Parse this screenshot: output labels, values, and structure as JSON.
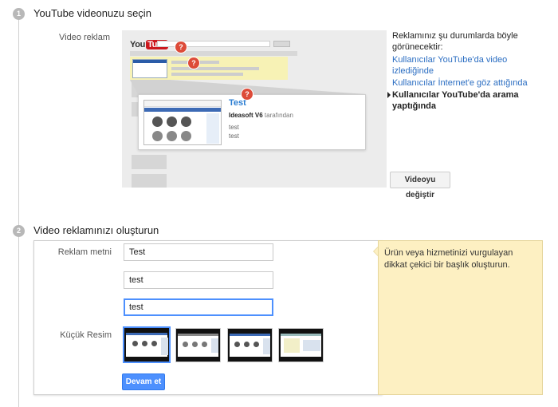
{
  "step1": {
    "number": "1",
    "title": "YouTube videonuzu seçin",
    "row_label": "Video reklam",
    "preview": {
      "logo_you": "You",
      "logo_tube": "Tube",
      "ad_title": "Test",
      "ad_channel": "Ideasoft V6",
      "ad_by": "tarafından",
      "ad_line1": "test",
      "ad_line2": "test",
      "marker": "?"
    },
    "appear": {
      "title": "Reklamınız şu durumlarda böyle görünecektir:",
      "options": [
        {
          "label": "Kullanıcılar YouTube'da video izlediğinde",
          "active": false
        },
        {
          "label": "Kullanıcılar İnternet'e göz attığında",
          "active": false
        },
        {
          "label": "Kullanıcılar YouTube'da arama yaptığında",
          "active": true
        }
      ]
    },
    "change_button": "Videoyu değiştir"
  },
  "step2": {
    "number": "2",
    "title": "Video reklamınızı oluşturun",
    "ad_text_label": "Reklam metni",
    "fields": [
      {
        "value": "Test"
      },
      {
        "value": "test"
      },
      {
        "value": "test"
      }
    ],
    "thumbnail_label": "Küçük Resim",
    "thumbnails": [
      {
        "selected": true
      },
      {
        "selected": false
      },
      {
        "selected": false
      },
      {
        "selected": false
      }
    ],
    "continue_button": "Devam et",
    "tip": "Ürün veya hizmetinizi vurgulayan dikkat çekici bir başlık oluşturun."
  },
  "colors": {
    "accent_blue": "#4d90fe",
    "link_blue": "#2a6dc2",
    "marker_red": "#dd4b39",
    "tip_bg": "#fdf0c2"
  }
}
